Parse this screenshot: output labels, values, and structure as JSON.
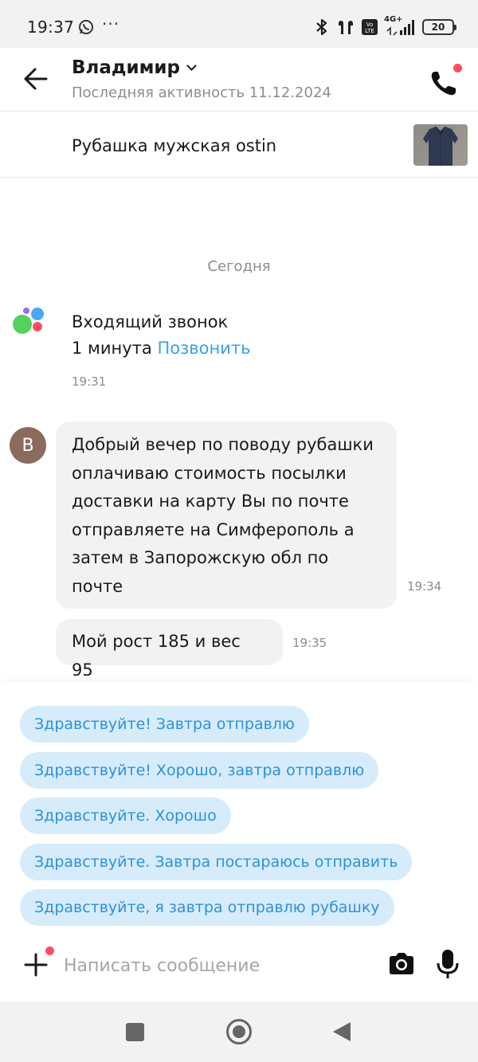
{
  "status_bar": {
    "time": "19:37",
    "overflow": "···",
    "network": "4G+",
    "battery": "20",
    "icons": [
      "whatsapp-icon",
      "bluetooth-icon",
      "headphones-icon",
      "volte-icon",
      "signal-icon",
      "battery-icon"
    ]
  },
  "header": {
    "name": "Владимир",
    "last_seen": "Последняя активность 11.12.2024",
    "icons": [
      "back-arrow-icon",
      "chevron-down-icon",
      "phone-icon"
    ]
  },
  "product": {
    "title": "Рубашка мужская ostin"
  },
  "chat": {
    "date_separator": "Сегодня",
    "system_message": {
      "line1": "Входящий звонок",
      "duration": "1 минута",
      "action": "Позвонить",
      "time": "19:31"
    },
    "avatar_letter": "В",
    "messages": [
      {
        "lines": [
          "Добрый вечер по поводу рубашки",
          "оплачиваю стоимость посылки",
          "доставки на карту Вы по почте",
          "отправляете на Симферополь а",
          "затем в Запорожскую обл по",
          "почте"
        ],
        "time": "19:34"
      },
      {
        "lines": [
          "Мой рост 185 и вес 95"
        ],
        "time": "19:35"
      }
    ]
  },
  "quick_replies": [
    "Здравствуйте! Завтра отправлю",
    "Здравствуйте! Хорошо, завтра отправлю",
    "Здравствуйте. Хорошо",
    "Здравствуйте. Завтра постараюсь отправить",
    "Здравствуйте, я завтра отправлю рубашку"
  ],
  "input": {
    "placeholder": "Написать сообщение",
    "value": ""
  },
  "colors": {
    "accent_link": "#3aa0ec",
    "chip_bg": "#d6ecfb",
    "chip_text": "#2f8fde",
    "notification_dot": "#ff4f5e",
    "bubble_bg": "#f2f2f2"
  }
}
